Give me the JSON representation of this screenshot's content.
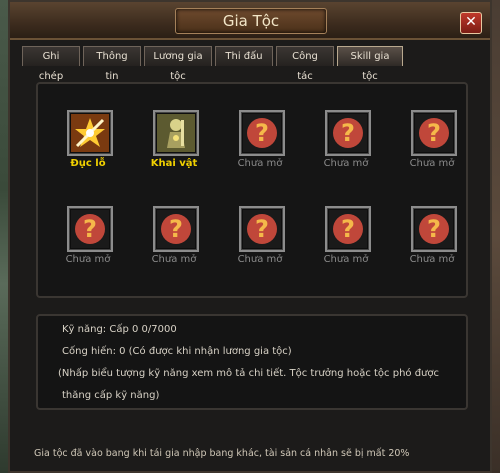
{
  "window": {
    "title": "Gia Tộc",
    "close_icon": "close-icon"
  },
  "tabs": [
    {
      "label": "Ghi chép",
      "active": false
    },
    {
      "label": "Thông tin",
      "active": false
    },
    {
      "label": "Lương gia tộc",
      "active": false
    },
    {
      "label": "Thi đấu",
      "active": false
    },
    {
      "label": "Công tác",
      "active": false
    },
    {
      "label": "Skill gia tộc",
      "active": true
    }
  ],
  "skills": [
    {
      "label": "Đục lỗ",
      "icon": "puncture-skill-icon",
      "unlocked": true
    },
    {
      "label": "Khai vật",
      "icon": "knight-skill-icon",
      "unlocked": true
    },
    {
      "label": "Chưa mở",
      "icon": "locked-question-icon",
      "unlocked": false
    },
    {
      "label": "Chưa mở",
      "icon": "locked-question-icon",
      "unlocked": false
    },
    {
      "label": "Chưa mở",
      "icon": "locked-question-icon",
      "unlocked": false
    },
    {
      "label": "Chưa mở",
      "icon": "locked-question-icon",
      "unlocked": false
    },
    {
      "label": "Chưa mở",
      "icon": "locked-question-icon",
      "unlocked": false
    },
    {
      "label": "Chưa mở",
      "icon": "locked-question-icon",
      "unlocked": false
    },
    {
      "label": "Chưa mở",
      "icon": "locked-question-icon",
      "unlocked": false
    },
    {
      "label": "Chưa mở",
      "icon": "locked-question-icon",
      "unlocked": false
    }
  ],
  "info": {
    "skill_level": "Kỹ năng: Cấp 0 0/7000",
    "contribution": "Cống hiến: 0 (Có được khi nhận lương gia tộc)",
    "hint_line1": "(Nhấp biểu tượng kỹ năng xem mô tả chi tiết. Tộc trưởng hoặc tộc phó được",
    "hint_line2": "thăng cấp kỹ năng)"
  },
  "footer_note": "Gia tộc đã vào bang khi tái gia nhập bang khác, tài sản cá nhân sẽ bị mất 20%",
  "colors": {
    "unlocked_label": "#f0d000",
    "locked_label": "#8a8a8a",
    "locked_icon_bg": "#c0473a"
  }
}
